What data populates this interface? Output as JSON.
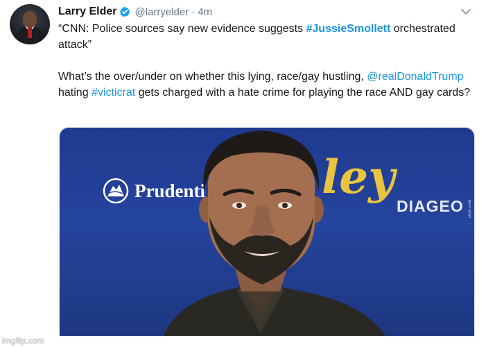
{
  "tweet": {
    "author_name": "Larry Elder",
    "handle": "@larryelder",
    "separator": "·",
    "time": "4m",
    "line1_pre": "“CNN: Police sources say new evidence suggests ",
    "line1_hashtag": "#JussieSmollett",
    "line1_post": " orchestrated attack”",
    "para2_pre": "What’s the over/under on whether this lying, race/gay hustling, ",
    "para2_mention": "@realDonaldTrump",
    "para2_mid": " hating ",
    "para2_hashtag": "#victicrat",
    "para2_post": " gets charged with a hate crime for playing the race AND gay cards?"
  },
  "photo": {
    "sponsor_left": "Prudenti",
    "sponsor_script": "ley",
    "sponsor_right": "DIAGEO",
    "credit": "photo credit"
  },
  "watermark": "imgflip.com",
  "colors": {
    "link": "#1b95e0",
    "verified": "#1da1f2",
    "text": "#14171a",
    "muted": "#657786"
  },
  "icons": {
    "verified": "verified-badge-icon",
    "caret": "chevron-down-icon"
  }
}
